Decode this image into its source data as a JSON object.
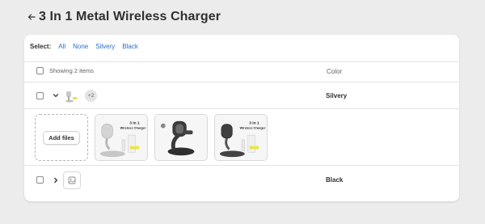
{
  "header": {
    "title": "3 In 1 Metal Wireless Charger",
    "back_icon": "arrow-left-icon"
  },
  "select": {
    "label": "Select:",
    "options": [
      "All",
      "None",
      "Silvery",
      "Black"
    ]
  },
  "table": {
    "showing": "Showing 2 items",
    "color_header": "Color"
  },
  "variants": [
    {
      "name": "Silvery",
      "extra_count": "+2",
      "expanded": true
    },
    {
      "name": "Black",
      "expanded": false
    }
  ],
  "media": {
    "add_files_label": "Add files",
    "images": [
      {
        "caption_line1": "3 in 1",
        "caption_line2": "Wireless Charger"
      },
      {
        "caption_line1": "",
        "caption_line2": ""
      },
      {
        "caption_line1": "3 in 1",
        "caption_line2": "Wireless Charger"
      }
    ]
  },
  "colors": {
    "link": "#2c6ecb",
    "text": "#303030",
    "background": "#ececec"
  }
}
